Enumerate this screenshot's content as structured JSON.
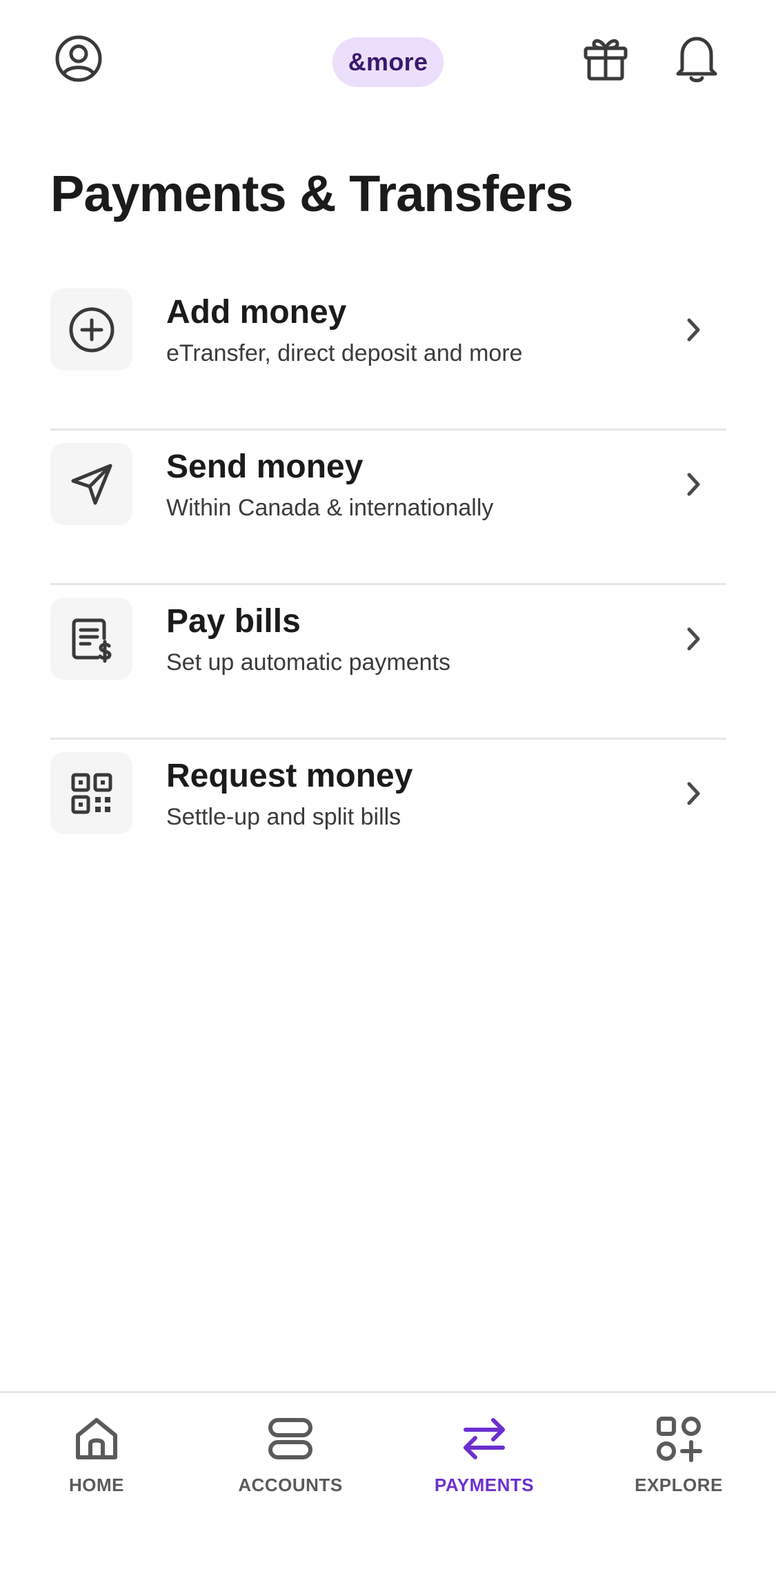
{
  "header": {
    "brand_label": "&more",
    "profile_icon": "profile-icon",
    "gift_icon": "gift-icon",
    "bell_icon": "bell-icon",
    "brand_pill_color": "#ecdffb"
  },
  "page": {
    "title": "Payments & Transfers"
  },
  "actions": [
    {
      "icon": "add-circle-icon",
      "title": "Add money",
      "subtitle": "eTransfer, direct deposit and more"
    },
    {
      "icon": "paper-plane-icon",
      "title": "Send money",
      "subtitle": "Within Canada & internationally"
    },
    {
      "icon": "bill-icon",
      "title": "Pay bills",
      "subtitle": "Set up automatic payments"
    },
    {
      "icon": "qr-code-icon",
      "title": "Request money",
      "subtitle": "Settle-up and split bills"
    }
  ],
  "bottom_nav": {
    "active_color": "#6c2fd0",
    "items": [
      {
        "label": "HOME",
        "icon": "home-icon",
        "active": false
      },
      {
        "label": "ACCOUNTS",
        "icon": "accounts-icon",
        "active": false
      },
      {
        "label": "PAYMENTS",
        "icon": "transfer-arrows-icon",
        "active": true
      },
      {
        "label": "EXPLORE",
        "icon": "explore-grid-icon",
        "active": false
      }
    ]
  }
}
